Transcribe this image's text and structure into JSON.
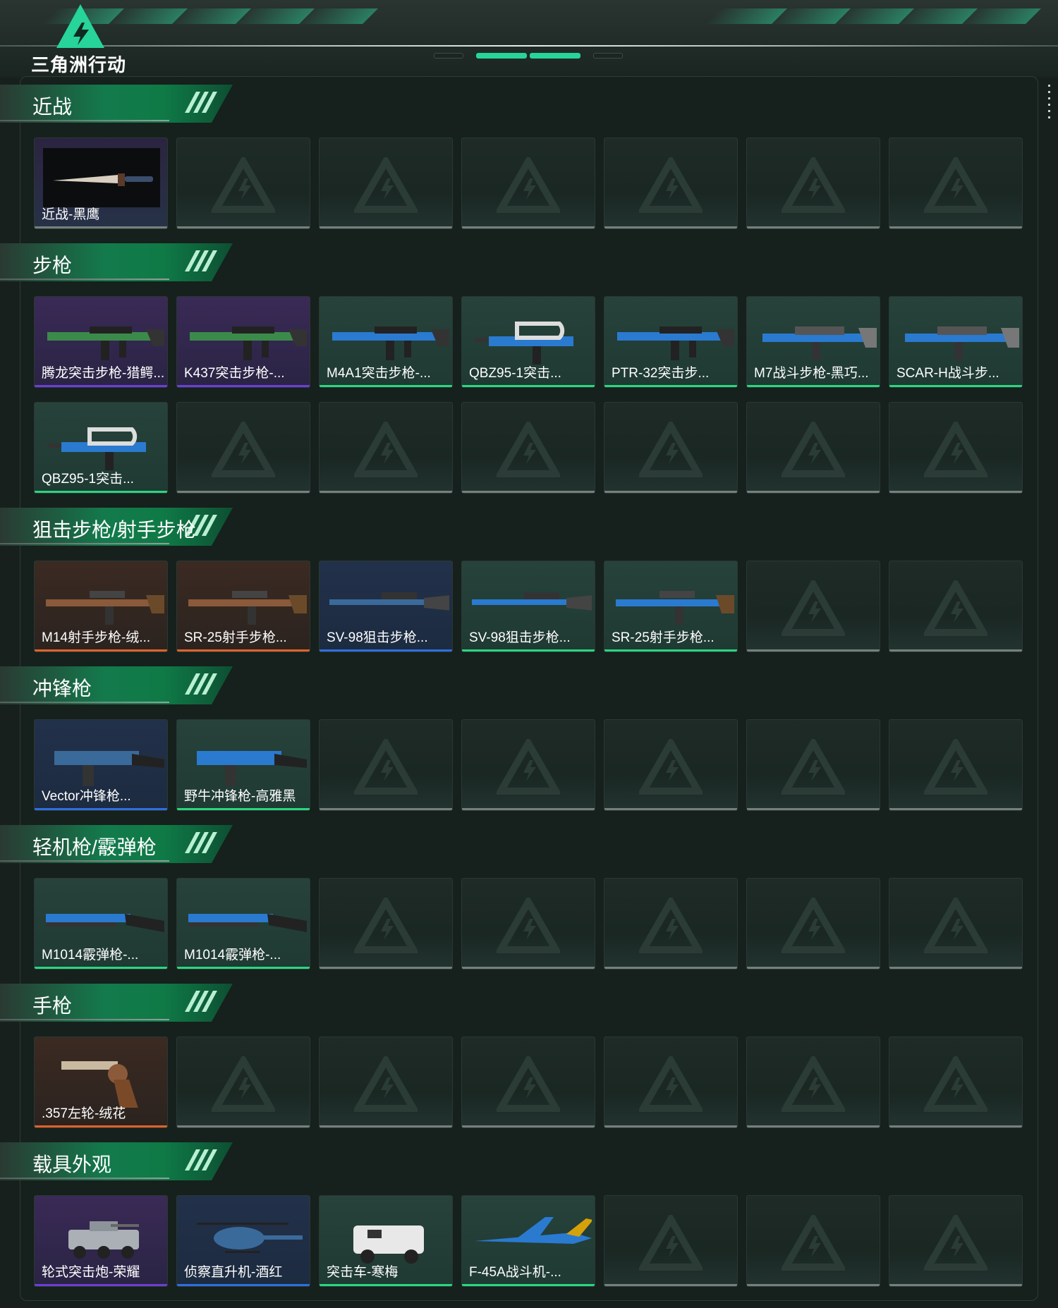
{
  "brand": {
    "name": "三角洲行动",
    "accent": "#27d49a"
  },
  "colors": {
    "purple": "#6b3fd6",
    "orange": "#e0622a",
    "blue": "#2e6fe0",
    "green": "#2ad67f",
    "empty": "#75807c"
  },
  "sections": [
    {
      "title": "近战",
      "items": [
        {
          "label": "近战-黑鹰",
          "rarity": "empty",
          "icon": "knife-icon"
        }
      ]
    },
    {
      "title": "步枪",
      "items": [
        {
          "label": "腾龙突击步枪-猎鳄...",
          "rarity": "purple",
          "icon": "assault-rifle-icon"
        },
        {
          "label": "K437突击步枪-...",
          "rarity": "purple",
          "icon": "assault-rifle-icon"
        },
        {
          "label": "M4A1突击步枪-...",
          "rarity": "green",
          "icon": "assault-rifle-icon"
        },
        {
          "label": "QBZ95-1突击...",
          "rarity": "green",
          "icon": "bullpup-rifle-icon"
        },
        {
          "label": "PTR-32突击步...",
          "rarity": "green",
          "icon": "assault-rifle-icon"
        },
        {
          "label": "M7战斗步枪-黑巧...",
          "rarity": "green",
          "icon": "battle-rifle-icon"
        },
        {
          "label": "SCAR-H战斗步...",
          "rarity": "green",
          "icon": "battle-rifle-icon"
        },
        {
          "label": "QBZ95-1突击...",
          "rarity": "green",
          "icon": "bullpup-rifle-icon"
        }
      ]
    },
    {
      "title": "狙击步枪/射手步枪",
      "items": [
        {
          "label": "M14射手步枪-绒...",
          "rarity": "orange",
          "icon": "marksman-rifle-icon"
        },
        {
          "label": "SR-25射手步枪...",
          "rarity": "orange",
          "icon": "marksman-rifle-icon"
        },
        {
          "label": "SV-98狙击步枪...",
          "rarity": "blue",
          "icon": "sniper-rifle-icon"
        },
        {
          "label": "SV-98狙击步枪...",
          "rarity": "green",
          "icon": "sniper-rifle-icon"
        },
        {
          "label": "SR-25射手步枪...",
          "rarity": "green",
          "icon": "marksman-rifle-icon"
        }
      ]
    },
    {
      "title": "冲锋枪",
      "items": [
        {
          "label": "Vector冲锋枪...",
          "rarity": "blue",
          "icon": "smg-icon"
        },
        {
          "label": "野牛冲锋枪-高雅黑",
          "rarity": "green",
          "icon": "smg-icon"
        }
      ]
    },
    {
      "title": "轻机枪/霰弹枪",
      "items": [
        {
          "label": "M1014霰弹枪-...",
          "rarity": "green",
          "icon": "shotgun-icon"
        },
        {
          "label": "M1014霰弹枪-...",
          "rarity": "green",
          "icon": "shotgun-icon"
        }
      ]
    },
    {
      "title": "手枪",
      "items": [
        {
          "label": ".357左轮-绒花",
          "rarity": "orange",
          "icon": "revolver-icon"
        }
      ]
    },
    {
      "title": "载具外观",
      "items": [
        {
          "label": "轮式突击炮-荣耀",
          "rarity": "purple",
          "icon": "armored-vehicle-icon"
        },
        {
          "label": "侦察直升机-酒红",
          "rarity": "blue",
          "icon": "helicopter-icon"
        },
        {
          "label": "突击车-寒梅",
          "rarity": "green",
          "icon": "assault-vehicle-icon"
        },
        {
          "label": "F-45A战斗机-...",
          "rarity": "green",
          "icon": "fighter-jet-icon"
        }
      ]
    }
  ]
}
